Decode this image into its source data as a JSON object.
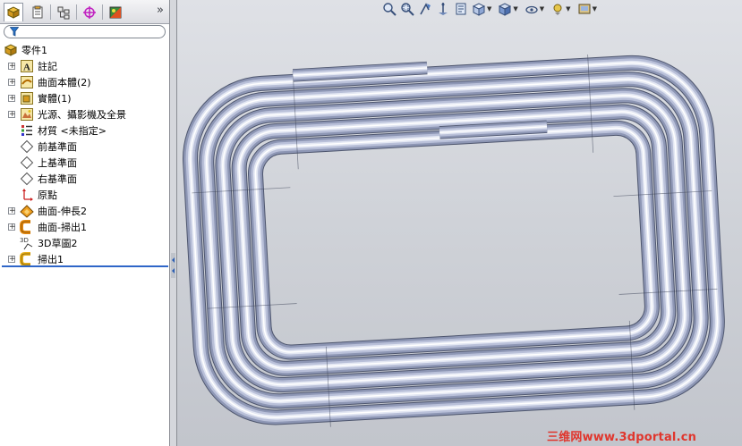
{
  "tree": {
    "root": "零件1",
    "items": [
      {
        "label": "註記",
        "icon": "annotation-icon",
        "expandable": true
      },
      {
        "label": "曲面本體(2)",
        "icon": "surface-bodies-icon",
        "expandable": true
      },
      {
        "label": "實體(1)",
        "icon": "solid-bodies-icon",
        "expandable": true
      },
      {
        "label": "光源、攝影機及全景",
        "icon": "lights-cameras-icon",
        "expandable": true
      },
      {
        "label": "材質 <未指定>",
        "icon": "material-icon",
        "expandable": false
      },
      {
        "label": "前基準面",
        "icon": "plane-icon",
        "expandable": false
      },
      {
        "label": "上基準面",
        "icon": "plane-icon",
        "expandable": false
      },
      {
        "label": "右基準面",
        "icon": "plane-icon",
        "expandable": false
      },
      {
        "label": "原點",
        "icon": "origin-icon",
        "expandable": false
      },
      {
        "label": "曲面-伸長2",
        "icon": "surface-extrude-icon",
        "expandable": true
      },
      {
        "label": "曲面-掃出1",
        "icon": "surface-sweep-icon",
        "expandable": true
      },
      {
        "label": "3D草圖2",
        "icon": "3d-sketch-icon",
        "expandable": false
      },
      {
        "label": "掃出1",
        "icon": "sweep-icon",
        "expandable": true
      }
    ]
  },
  "tabs": [
    "feature-manager-tab",
    "property-manager-tab",
    "configuration-manager-tab",
    "dimxpert-tab",
    "display-manager-tab"
  ],
  "heads_up_toolbar": [
    "zoom-to-fit-icon",
    "zoom-to-area-icon",
    "previous-view-icon",
    "section-view-icon",
    "dynamic-annotation-icon",
    "view-orientation-icon",
    "display-style-icon",
    "hide-show-items-icon",
    "edit-appearance-icon",
    "apply-scene-icon",
    "view-settings-icon"
  ],
  "watermark": "三维网www.3dportal.cn",
  "colors": {
    "rollback_bar": "#2f66c8",
    "watermark": "#e0362d",
    "tube": "#b9c0d9"
  }
}
